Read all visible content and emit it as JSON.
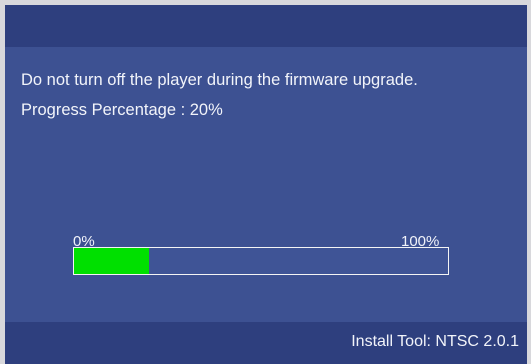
{
  "screen": {
    "message": "Do not turn off the player during the firmware upgrade.",
    "progress_label": "Progress Percentage : 20%",
    "progress_fraction": 0.2,
    "progress_min_label": "0%",
    "progress_max_label": "100%",
    "footer_text": "Install Tool: NTSC 2.0.1"
  },
  "colors": {
    "background": "#3d5192",
    "bar_band": "#2e3f7e",
    "progress_fill": "#00e000",
    "text": "#f2f4fa"
  }
}
